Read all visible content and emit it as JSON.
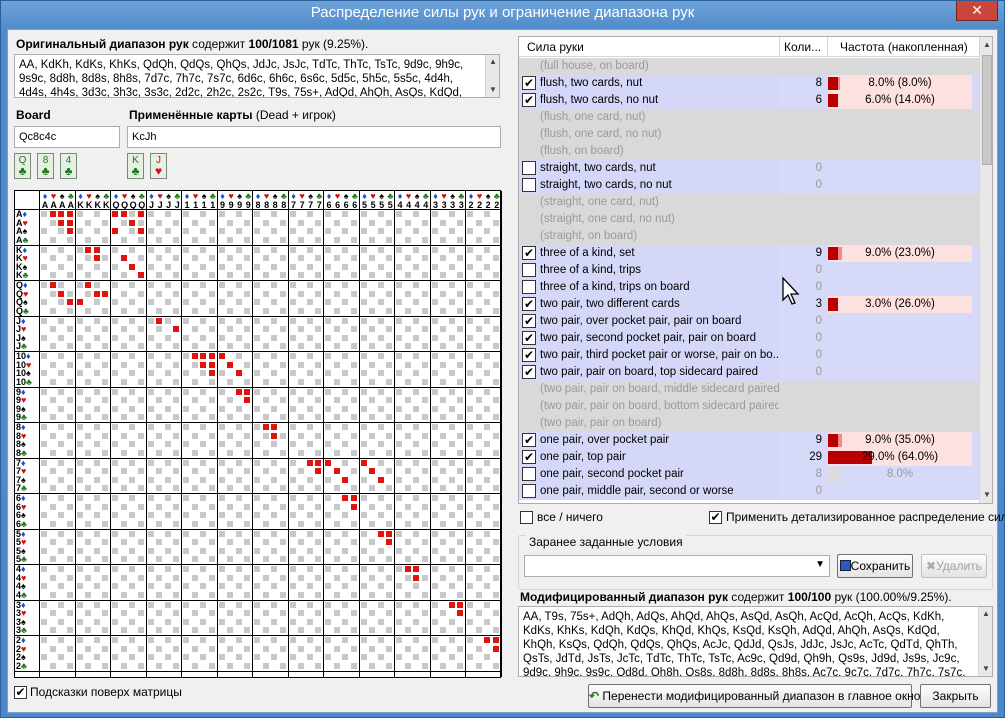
{
  "window": {
    "title": "Распределение силы рук и ограничение диапазона рук",
    "close_glyph": "✕"
  },
  "original": {
    "title_bold": "Оригинальный диапазон рук",
    "title_rest": " содержит ",
    "count": "100/1081",
    "count_suffix": " рук (9.25%).",
    "text": "AA, KdKh, KdKs, KhKs, QdQh, QdQs, QhQs, JdJc, JsJc, TdTc, ThTc, TsTc, 9d9c, 9h9c, 9s9c, 8d8h, 8d8s, 8h8s, 7d7c, 7h7c, 7s7c, 6d6c, 6h6c, 6s6c, 5d5c, 5h5c, 5s5c, 4d4h, 4d4s, 4h4s, 3d3c, 3h3c, 3s3c, 2d2c, 2h2c, 2s2c, T9s, 75s+, AdQd, AhQh, AsQs, KdQd, KhQh, KsQs, AcJc,"
  },
  "board": {
    "label": "Board",
    "value": "Qc8c4c",
    "cards": [
      {
        "rank": "Q",
        "suit": "♣",
        "color": "#1a7a1a"
      },
      {
        "rank": "8",
        "suit": "♣",
        "color": "#1a7a1a"
      },
      {
        "rank": "4",
        "suit": "♣",
        "color": "#1a7a1a"
      }
    ]
  },
  "dead": {
    "label_bold": "Применённые карты",
    "label_rest": " (Dead + игрок)",
    "value": "KcJh",
    "cards": [
      {
        "rank": "K",
        "suit": "♣",
        "color": "#1a7a1a"
      },
      {
        "rank": "J",
        "suit": "♥",
        "color": "#d01010"
      }
    ]
  },
  "matrix": {
    "ranks": [
      "A",
      "K",
      "Q",
      "J",
      "10",
      "9",
      "8",
      "7",
      "6",
      "5",
      "4",
      "3",
      "2"
    ],
    "suits": [
      {
        "s": "♦",
        "c": "#1d4fd0"
      },
      {
        "s": "♥",
        "c": "#d01010"
      },
      {
        "s": "♠",
        "c": "#000000"
      },
      {
        "s": "♣",
        "c": "#1a7a1a"
      }
    ],
    "red_cells": [
      [
        0,
        1,
        0,
        2
      ],
      [
        0,
        1,
        0,
        3
      ],
      [
        0,
        2,
        0,
        3
      ],
      [
        0,
        1,
        0,
        4
      ],
      [
        0,
        2,
        0,
        4
      ],
      [
        0,
        3,
        0,
        4
      ],
      [
        0,
        1,
        2,
        2
      ],
      [
        0,
        2,
        2,
        3
      ],
      [
        0,
        3,
        2,
        4
      ],
      [
        0,
        1,
        2,
        1
      ],
      [
        0,
        3,
        2,
        1
      ],
      [
        0,
        1,
        2,
        4
      ],
      [
        1,
        1,
        1,
        2
      ],
      [
        1,
        1,
        1,
        3
      ],
      [
        1,
        2,
        1,
        3
      ],
      [
        1,
        2,
        2,
        2
      ],
      [
        1,
        3,
        2,
        3
      ],
      [
        1,
        4,
        2,
        4
      ],
      [
        2,
        2,
        1,
        4
      ],
      [
        2,
        3,
        1,
        1
      ],
      [
        2,
        1,
        0,
        2
      ],
      [
        2,
        2,
        0,
        3
      ],
      [
        2,
        3,
        0,
        4
      ],
      [
        2,
        1,
        1,
        2
      ],
      [
        2,
        2,
        1,
        3
      ],
      [
        3,
        1,
        3,
        2
      ],
      [
        3,
        2,
        3,
        4
      ],
      [
        4,
        1,
        4,
        2
      ],
      [
        4,
        1,
        4,
        3
      ],
      [
        4,
        2,
        4,
        3
      ],
      [
        4,
        1,
        4,
        4
      ],
      [
        4,
        2,
        4,
        4
      ],
      [
        4,
        3,
        4,
        4
      ],
      [
        4,
        1,
        5,
        1
      ],
      [
        4,
        2,
        5,
        2
      ],
      [
        4,
        3,
        5,
        3
      ],
      [
        5,
        1,
        5,
        3
      ],
      [
        5,
        1,
        5,
        4
      ],
      [
        5,
        2,
        5,
        4
      ],
      [
        6,
        1,
        6,
        2
      ],
      [
        6,
        1,
        6,
        3
      ],
      [
        6,
        2,
        6,
        3
      ],
      [
        7,
        1,
        7,
        3
      ],
      [
        7,
        1,
        7,
        4
      ],
      [
        7,
        2,
        7,
        4
      ],
      [
        7,
        1,
        8,
        1
      ],
      [
        7,
        2,
        8,
        2
      ],
      [
        7,
        3,
        8,
        3
      ],
      [
        7,
        1,
        9,
        1
      ],
      [
        7,
        2,
        9,
        2
      ],
      [
        7,
        3,
        9,
        3
      ],
      [
        8,
        1,
        8,
        3
      ],
      [
        8,
        1,
        8,
        4
      ],
      [
        8,
        2,
        8,
        4
      ],
      [
        9,
        1,
        9,
        3
      ],
      [
        9,
        1,
        9,
        4
      ],
      [
        9,
        2,
        9,
        4
      ],
      [
        10,
        1,
        10,
        2
      ],
      [
        10,
        1,
        10,
        3
      ],
      [
        10,
        2,
        10,
        3
      ],
      [
        11,
        1,
        11,
        3
      ],
      [
        11,
        1,
        11,
        4
      ],
      [
        11,
        2,
        11,
        4
      ],
      [
        12,
        1,
        12,
        3
      ],
      [
        12,
        1,
        12,
        4
      ],
      [
        12,
        2,
        12,
        4
      ]
    ]
  },
  "table": {
    "headers": {
      "strength": "Сила руки",
      "count": "Коли...",
      "freq": "Частота (накопленная)"
    },
    "rows": [
      {
        "name": "(full house, on board)",
        "state": "gray",
        "checked": false,
        "count": "",
        "pct": "",
        "bar": 0,
        "cum": 0
      },
      {
        "name": "flush, two cards, nut",
        "state": "blue",
        "checked": true,
        "count": "8",
        "pct": "8.0% (8.0%)",
        "bar": 8,
        "cum": 8
      },
      {
        "name": "flush, two cards, no nut",
        "state": "blue",
        "checked": true,
        "count": "6",
        "pct": "6.0% (14.0%)",
        "bar": 6,
        "cum": 14
      },
      {
        "name": "(flush, one card, nut)",
        "state": "gray",
        "checked": false,
        "count": "",
        "pct": "",
        "bar": 0,
        "cum": 0
      },
      {
        "name": "(flush, one card, no nut)",
        "state": "gray",
        "checked": false,
        "count": "",
        "pct": "",
        "bar": 0,
        "cum": 0
      },
      {
        "name": "(flush, on board)",
        "state": "gray",
        "checked": false,
        "count": "",
        "pct": "",
        "bar": 0,
        "cum": 0
      },
      {
        "name": "straight, two cards, nut",
        "state": "blue",
        "checked": false,
        "count": "0",
        "pct": "",
        "bar": 0,
        "cum": 0
      },
      {
        "name": "straight, two cards, no nut",
        "state": "blue",
        "checked": false,
        "count": "0",
        "pct": "",
        "bar": 0,
        "cum": 0
      },
      {
        "name": "(straight, one card, nut)",
        "state": "gray",
        "checked": false,
        "count": "",
        "pct": "",
        "bar": 0,
        "cum": 0
      },
      {
        "name": "(straight, one card, no nut)",
        "state": "gray",
        "checked": false,
        "count": "",
        "pct": "",
        "bar": 0,
        "cum": 0
      },
      {
        "name": "(straight, on board)",
        "state": "gray",
        "checked": false,
        "count": "",
        "pct": "",
        "bar": 0,
        "cum": 0
      },
      {
        "name": "three of a kind, set",
        "state": "blue",
        "checked": true,
        "count": "9",
        "pct": "9.0% (23.0%)",
        "bar": 9,
        "cum": 23
      },
      {
        "name": "three of a kind, trips",
        "state": "blue",
        "checked": false,
        "count": "0",
        "pct": "",
        "bar": 0,
        "cum": 0
      },
      {
        "name": "three of a kind, trips on board",
        "state": "blue",
        "checked": false,
        "count": "0",
        "pct": "",
        "bar": 0,
        "cum": 0
      },
      {
        "name": "two pair, two different cards",
        "state": "blue",
        "checked": true,
        "count": "3",
        "pct": "3.0% (26.0%)",
        "bar": 3,
        "cum": 26
      },
      {
        "name": "two pair, over pocket pair, pair on board",
        "state": "blue",
        "checked": true,
        "count": "0",
        "pct": "",
        "bar": 0,
        "cum": 0
      },
      {
        "name": "two pair, second pocket pair, pair on board",
        "state": "blue",
        "checked": true,
        "count": "0",
        "pct": "",
        "bar": 0,
        "cum": 0
      },
      {
        "name": "two pair, third pocket pair or worse, pair on bo...",
        "state": "blue",
        "checked": true,
        "count": "0",
        "pct": "",
        "bar": 0,
        "cum": 0
      },
      {
        "name": "two pair, pair on board, top sidecard paired",
        "state": "blue",
        "checked": true,
        "count": "0",
        "pct": "",
        "bar": 0,
        "cum": 0
      },
      {
        "name": "(two pair, pair on board, middle sidecard paired)",
        "state": "gray",
        "checked": false,
        "count": "",
        "pct": "",
        "bar": 0,
        "cum": 0
      },
      {
        "name": "(two pair, pair on board, bottom sidecard paired)",
        "state": "gray",
        "checked": false,
        "count": "",
        "pct": "",
        "bar": 0,
        "cum": 0
      },
      {
        "name": "(two pair, pair on board)",
        "state": "gray",
        "checked": false,
        "count": "",
        "pct": "",
        "bar": 0,
        "cum": 0
      },
      {
        "name": "one pair, over pocket pair",
        "state": "blue",
        "checked": true,
        "count": "9",
        "pct": "9.0% (35.0%)",
        "bar": 9,
        "cum": 35
      },
      {
        "name": "one pair, top pair",
        "state": "blue",
        "checked": true,
        "count": "29",
        "pct": "29.0% (64.0%)",
        "bar": 29,
        "cum": 64
      },
      {
        "name": "one pair, second pocket pair",
        "state": "blue",
        "checked": false,
        "count": "8",
        "pct": "8.0%",
        "bar": 8,
        "cum": 0,
        "dim": true
      },
      {
        "name": "one pair, middle pair, second or worse",
        "state": "blue",
        "checked": false,
        "count": "0",
        "pct": "",
        "bar": 0,
        "cum": 0
      }
    ]
  },
  "options": {
    "all_none": "все / ничего",
    "apply_detailed": "Применить детализированное распределение силы"
  },
  "preset": {
    "title": "Заранее заданные условия",
    "save": "Сохранить",
    "delete": "Удалить"
  },
  "modified": {
    "title_bold": "Модифицированный диапазон рук",
    "title_rest": " содержит ",
    "count": "100/100",
    "count_suffix": " рук (100.00%/9.25%).",
    "text": "AA, T9s, 75s+, AdQh, AdQs, AhQd, AhQs, AsQd, AsQh, AcQd, AcQh, AcQs, KdKh, KdKs, KhKs, KdQh, KdQs, KhQd, KhQs, KsQd, KsQh, AdQd, AhQh, AsQs, KdQd, KhQh, KsQs, QdQh, QdQs, QhQs, AcJc, QdJd, QsJs, JdJc, JsJc, AcTc, QdTd, QhTh, QsTs, JdTd, JsTs, JcTc, TdTc, ThTc, TsTc, Ac9c, Qd9d, Qh9h, Qs9s, Jd9d, Js9s, Jc9c, 9d9c, 9h9c, 9s9c, Qd8d, Qh8h, Qs8s, 8d8h, 8d8s, 8h8s, Ac7c, 9c7c, 7d7c, 7h7c, 7s7c, Ac6c, 6d6c, 6h6c,"
  },
  "matrix_hint": "Подсказки поверх матрицы",
  "buttons": {
    "transfer": "Перенести модифицированный диапазон в главное окно",
    "close": "Закрыть"
  },
  "colors": {
    "blue_row": "#d6d9f7",
    "gray_row": "#d9d9d9",
    "bar_dark": "#b80000",
    "bar_light": "#f08a8a",
    "bar_bg": "#fde0e0"
  }
}
